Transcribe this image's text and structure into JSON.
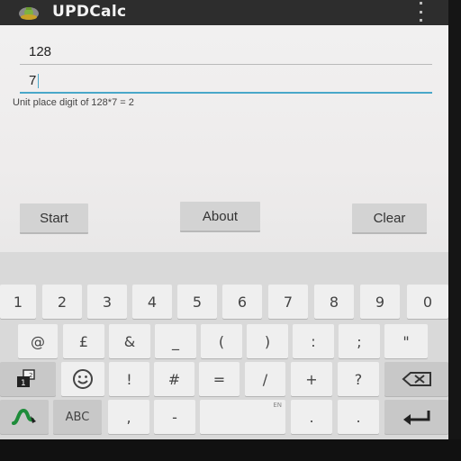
{
  "app": {
    "title": "UPDCalc"
  },
  "inputs": {
    "first_value": "128",
    "second_value": "7"
  },
  "result_text": "Unit place digit of 128*7 = 2",
  "buttons": {
    "start": "Start",
    "about": "About",
    "clear": "Clear"
  },
  "keyboard": {
    "row1": [
      "1",
      "2",
      "3",
      "4",
      "5",
      "6",
      "7",
      "8",
      "9",
      "0"
    ],
    "row2": [
      "@",
      "£",
      "&",
      "_",
      "(",
      ")",
      ":",
      ";",
      "\""
    ],
    "row3": [
      "!",
      "#",
      "=",
      "/",
      "+",
      "?"
    ],
    "row4": {
      "abc": "ABC",
      "comma": ",",
      "dash": "-",
      "period": ".",
      "space_hint": "EN"
    },
    "page_indicator": "1",
    "page_indicator_sup": "2"
  },
  "colors": {
    "accent": "#49a7c9",
    "titlebar": "#2d2d2d",
    "shift_icon": "#1e8c3a"
  },
  "icons": [
    "android-app-icon",
    "overflow-menu-icon",
    "symbols-page-icon",
    "emoji-icon",
    "backspace-icon",
    "swype-icon",
    "enter-icon"
  ]
}
